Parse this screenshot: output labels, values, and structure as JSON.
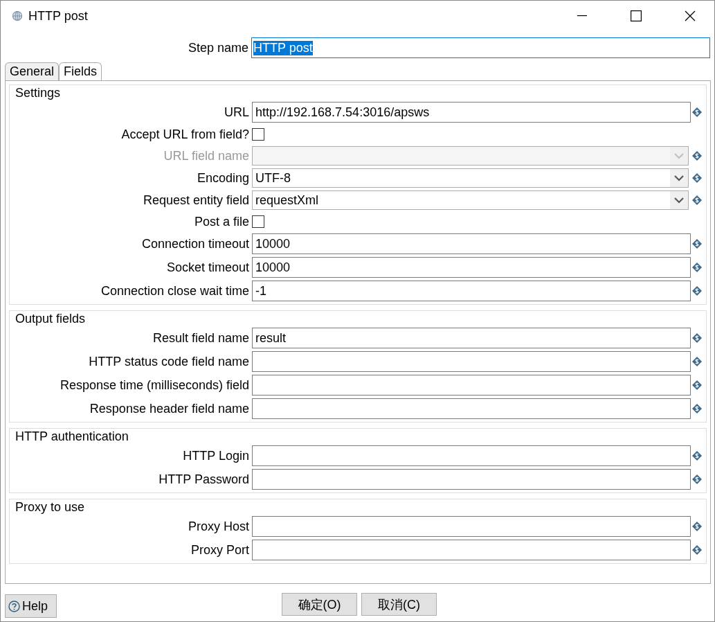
{
  "window": {
    "title": "HTTP post"
  },
  "step_name": {
    "label": "Step name",
    "value": "HTTP post",
    "selected": true
  },
  "tabs": [
    {
      "label": "General",
      "selected": true
    },
    {
      "label": "Fields",
      "selected": false
    }
  ],
  "groups": [
    {
      "title": "Settings",
      "rows": [
        {
          "kind": "text",
          "label": "URL",
          "value": "http://192.168.7.54:3016/apsws",
          "disabled": false
        },
        {
          "kind": "checkbox",
          "label": "Accept URL from field?",
          "checked": false,
          "disabled": false
        },
        {
          "kind": "combo",
          "label": "URL field name",
          "value": "",
          "disabled": true
        },
        {
          "kind": "combo",
          "label": "Encoding",
          "value": "UTF-8",
          "disabled": false
        },
        {
          "kind": "combo",
          "label": "Request entity field",
          "value": "requestXml",
          "disabled": false
        },
        {
          "kind": "checkbox",
          "label": "Post a file",
          "checked": false,
          "disabled": false
        },
        {
          "kind": "text",
          "label": "Connection timeout",
          "value": "10000",
          "disabled": false
        },
        {
          "kind": "text",
          "label": "Socket timeout",
          "value": "10000",
          "disabled": false
        },
        {
          "kind": "text",
          "label": "Connection close wait time",
          "value": "-1",
          "disabled": false
        }
      ]
    },
    {
      "title": "Output fields",
      "rows": [
        {
          "kind": "text",
          "label": "Result field name",
          "value": "result",
          "disabled": false
        },
        {
          "kind": "text",
          "label": "HTTP status code field name",
          "value": "",
          "disabled": false
        },
        {
          "kind": "text",
          "label": "Response time (milliseconds) field",
          "value": "",
          "disabled": false
        },
        {
          "kind": "text",
          "label": "Response header field name",
          "value": "",
          "disabled": false
        }
      ]
    },
    {
      "title": "HTTP authentication",
      "rows": [
        {
          "kind": "text",
          "label": "HTTP Login",
          "value": "",
          "disabled": false
        },
        {
          "kind": "text",
          "label": "HTTP Password",
          "value": "",
          "disabled": false
        }
      ]
    },
    {
      "title": "Proxy to use",
      "rows": [
        {
          "kind": "text",
          "label": "Proxy Host",
          "value": "",
          "disabled": false
        },
        {
          "kind": "text",
          "label": "Proxy Port",
          "value": "",
          "disabled": false
        }
      ]
    }
  ],
  "help": "Help",
  "buttons": [
    "确定(O)",
    "取消(C)"
  ]
}
